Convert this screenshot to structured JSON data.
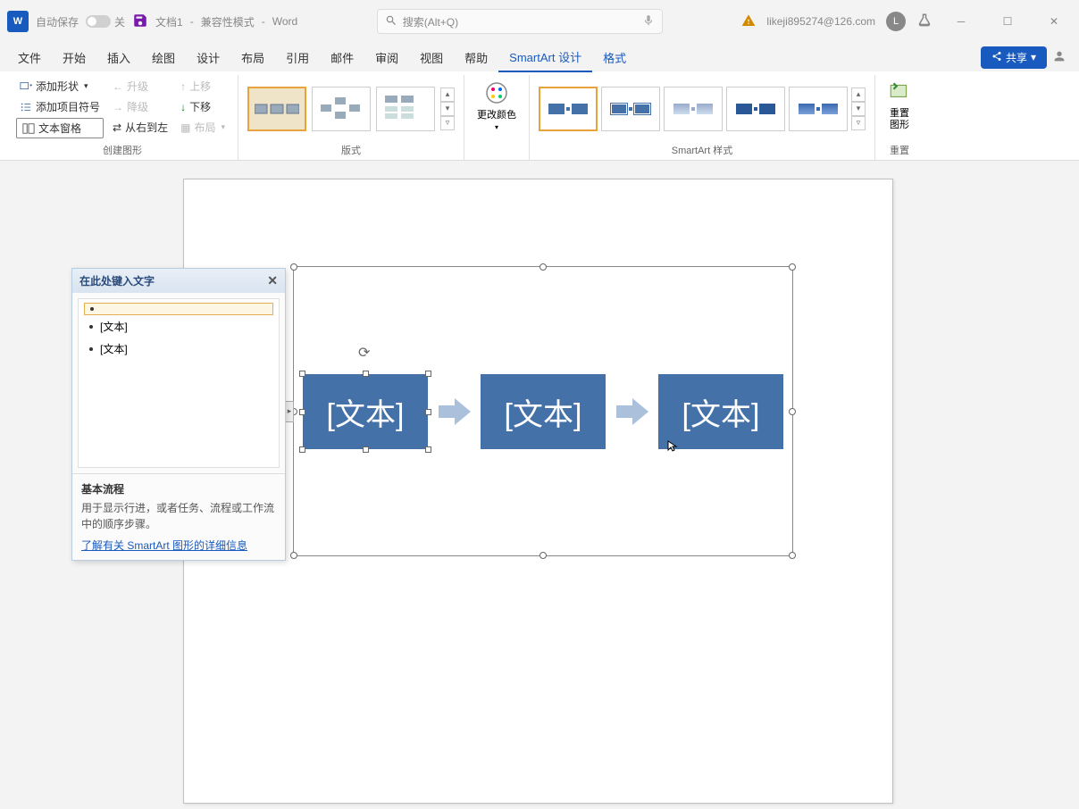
{
  "titlebar": {
    "autosave_label": "自动保存",
    "autosave_state": "关",
    "doc_name": "文档1",
    "compat_mode": "兼容性模式",
    "app_name": "Word",
    "search_placeholder": "搜索(Alt+Q)",
    "user_email": "likeji895274@126.com",
    "user_initial": "L"
  },
  "tabs": {
    "file": "文件",
    "home": "开始",
    "insert": "插入",
    "draw": "绘图",
    "design": "设计",
    "layout": "布局",
    "references": "引用",
    "mailings": "邮件",
    "review": "审阅",
    "view": "视图",
    "help": "帮助",
    "smartart_design": "SmartArt 设计",
    "format": "格式",
    "share": "共享"
  },
  "ribbon": {
    "create": {
      "add_shape": "添加形状",
      "add_bullet": "添加项目符号",
      "text_pane": "文本窗格",
      "promote": "升级",
      "demote": "降级",
      "rtl": "从右到左",
      "move_up": "上移",
      "move_down": "下移",
      "layout_btn": "布局",
      "group_label": "创建图形"
    },
    "layouts": {
      "group_label": "版式"
    },
    "colors": {
      "change_colors": "更改颜色"
    },
    "styles": {
      "group_label": "SmartArt 样式"
    },
    "reset": {
      "reset_graphic": "重置\n图形",
      "group_label": "重置"
    }
  },
  "text_pane": {
    "header": "在此处键入文字",
    "items": [
      "",
      "[文本]",
      "[文本]"
    ],
    "footer_title": "基本流程",
    "footer_desc": "用于显示行进，或者任务、流程或工作流中的顺序步骤。",
    "footer_link": "了解有关 SmartArt 图形的详细信息"
  },
  "smartart": {
    "box1": "[文本]",
    "box2": "[文本]",
    "box3": "[文本]"
  },
  "colors": {
    "accent": "#4472a8",
    "arrow": "#aac0db",
    "word_blue": "#185abd"
  }
}
